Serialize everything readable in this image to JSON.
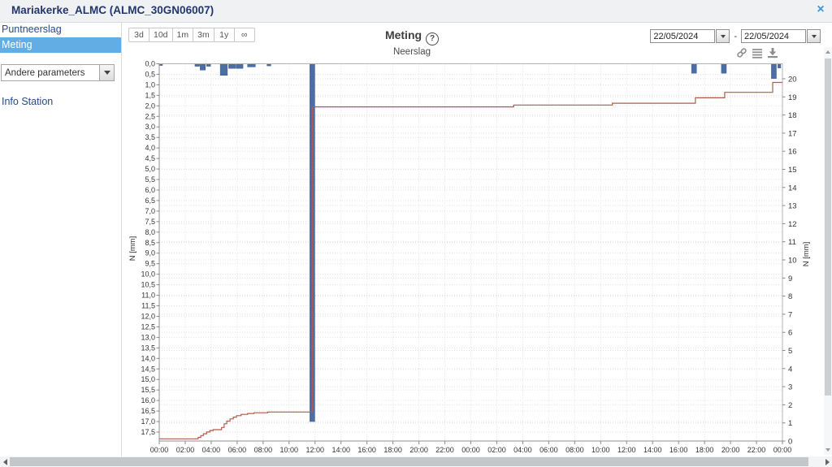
{
  "window": {
    "title": "Mariakerke_ALMC (ALMC_30GN06007)",
    "close_glyph": "×"
  },
  "sidebar": {
    "items": [
      {
        "label": "Puntneerslag",
        "selected": false
      },
      {
        "label": "Meting",
        "selected": true
      }
    ],
    "parameter_select": {
      "value": "Andere parameters"
    },
    "info_link": "Info Station"
  },
  "toolbar": {
    "ranges": [
      "3d",
      "10d",
      "1m",
      "3m",
      "1y",
      "∞"
    ],
    "title": "Meting",
    "help_glyph": "?",
    "subtitle": "Neerslag",
    "date_from": "22/05/2024",
    "date_to": "22/05/2024",
    "separator": "-",
    "icons": [
      "link-icon",
      "list-icon",
      "download-icon"
    ]
  },
  "chart_data": {
    "type": "bar",
    "title": "Neerslag",
    "station": "Mariakerke_ALMC (ALMC_30GN06007)",
    "x_axis": {
      "span_hours": 48,
      "tick_step_hours": 2,
      "labels": [
        "00:00",
        "02:00",
        "04:00",
        "06:00",
        "08:00",
        "10:00",
        "12:00",
        "14:00",
        "16:00",
        "18:00",
        "20:00",
        "22:00",
        "00:00",
        "02:00",
        "04:00",
        "06:00",
        "08:00",
        "10:00",
        "12:00",
        "14:00",
        "16:00",
        "18:00",
        "20:00",
        "22:00",
        "00:00"
      ]
    },
    "left_axis": {
      "label": "N [mm]",
      "min": 0,
      "max": 17.5,
      "step": 0.5,
      "inverted": true,
      "tick_labels": [
        "0,0",
        "0,5",
        "1,0",
        "1,5",
        "2,0",
        "2,5",
        "3,0",
        "3,5",
        "4,0",
        "4,5",
        "5,0",
        "5,5",
        "6,0",
        "6,5",
        "7,0",
        "7,5",
        "8,0",
        "8,5",
        "9,0",
        "9,5",
        "10,0",
        "10,5",
        "11,0",
        "11,5",
        "12,0",
        "12,5",
        "13,0",
        "13,5",
        "14,0",
        "14,5",
        "15,0",
        "15,5",
        "16,0",
        "16,5",
        "17,0",
        "17,5"
      ]
    },
    "right_axis": {
      "label": "N [mm]",
      "min": 0,
      "max": 20,
      "step": 1,
      "tick_labels": [
        "0",
        "1",
        "2",
        "3",
        "4",
        "5",
        "6",
        "7",
        "8",
        "9",
        "10",
        "11",
        "12",
        "13",
        "14",
        "15",
        "16",
        "17",
        "18",
        "19",
        "20"
      ]
    },
    "series": [
      {
        "name": "neerslag-intensiteit-bars",
        "type": "bar",
        "axis": "left",
        "color": "#4b6fa5",
        "bars": [
          [
            0,
            0.25,
            0.08
          ],
          [
            2.75,
            0.35,
            0.12
          ],
          [
            3.15,
            0.4,
            0.3
          ],
          [
            3.65,
            0.3,
            0.12
          ],
          [
            4.7,
            0.55,
            0.55
          ],
          [
            5.35,
            0.55,
            0.22
          ],
          [
            5.95,
            0.5,
            0.22
          ],
          [
            6.8,
            0.6,
            0.15
          ],
          [
            8.3,
            0.3,
            0.1
          ],
          [
            11.6,
            0.38,
            17.0
          ],
          [
            41.0,
            0.38,
            0.45
          ],
          [
            43.3,
            0.38,
            0.45
          ],
          [
            47.15,
            0.38,
            0.7
          ],
          [
            47.65,
            0.22,
            0.2
          ]
        ]
      },
      {
        "name": "neerslag-cumulatief-line",
        "type": "step-line",
        "axis": "right",
        "color": "#b05c49",
        "points": [
          [
            0,
            0.12
          ],
          [
            3.0,
            0.2
          ],
          [
            3.2,
            0.3
          ],
          [
            3.4,
            0.4
          ],
          [
            3.65,
            0.5
          ],
          [
            3.9,
            0.58
          ],
          [
            4.15,
            0.63
          ],
          [
            4.8,
            0.75
          ],
          [
            5.0,
            0.95
          ],
          [
            5.2,
            1.1
          ],
          [
            5.45,
            1.22
          ],
          [
            5.7,
            1.32
          ],
          [
            5.95,
            1.4
          ],
          [
            6.3,
            1.47
          ],
          [
            6.8,
            1.52
          ],
          [
            7.3,
            1.56
          ],
          [
            8.35,
            1.6
          ],
          [
            11.62,
            1.6
          ],
          [
            11.8,
            18.45
          ],
          [
            27.3,
            18.55
          ],
          [
            34.9,
            18.65
          ],
          [
            41.3,
            18.95
          ],
          [
            43.55,
            19.25
          ],
          [
            47.25,
            19.8
          ],
          [
            48,
            19.85
          ]
        ]
      }
    ],
    "grid": {
      "on": true,
      "style": "dotted"
    },
    "legend": "none",
    "colors": {
      "bar": "#4b6fa5",
      "line": "#b05c49",
      "selection": "#62aee4",
      "link_text": "#28488f"
    }
  }
}
